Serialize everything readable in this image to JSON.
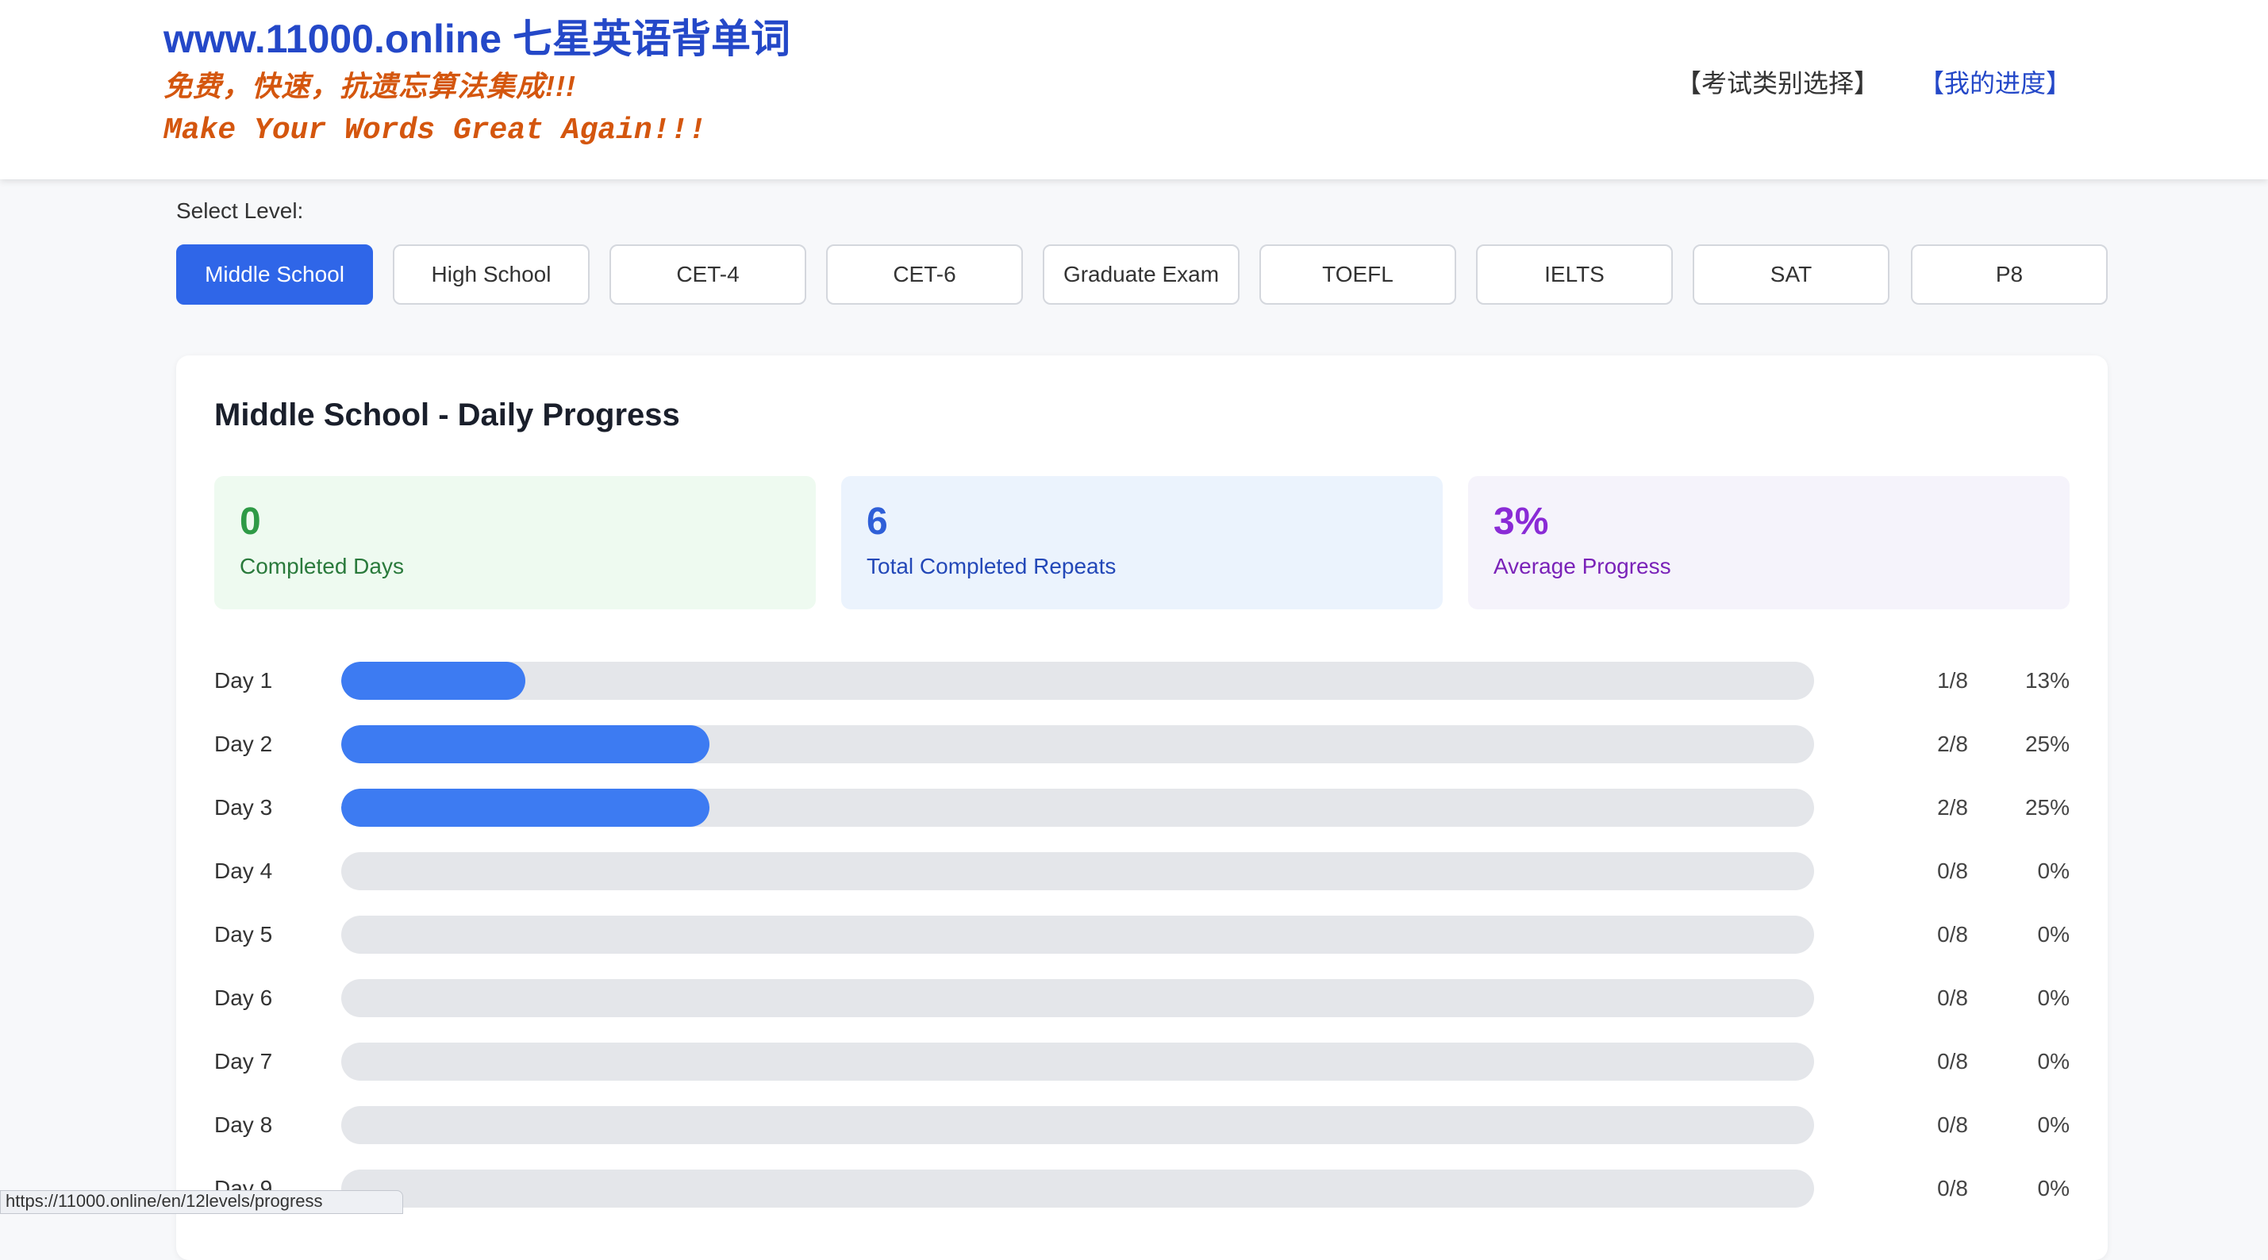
{
  "header": {
    "site_title": "www.11000.online 七星英语背单词",
    "slogan_cn": "免费，快速，抗遗忘算法集成!!!",
    "slogan_en": "Make Your Words Great Again!!!",
    "nav": {
      "exam_select": "【考试类别选择】",
      "my_progress": "【我的进度】"
    }
  },
  "level_select": {
    "label": "Select Level:",
    "active": "Middle School",
    "levels": [
      "Middle School",
      "High School",
      "CET-4",
      "CET-6",
      "Graduate Exam",
      "TOEFL",
      "IELTS",
      "SAT",
      "P8"
    ]
  },
  "progress": {
    "title": "Middle School - Daily Progress",
    "stats": {
      "completed_days": {
        "value": "0",
        "label": "Completed Days"
      },
      "total_repeats": {
        "value": "6",
        "label": "Total Completed Repeats"
      },
      "average_progress": {
        "value": "3%",
        "label": "Average Progress"
      }
    },
    "days": [
      {
        "label": "Day 1",
        "count": "1/8",
        "percent": "13%",
        "fraction": 0.125
      },
      {
        "label": "Day 2",
        "count": "2/8",
        "percent": "25%",
        "fraction": 0.25
      },
      {
        "label": "Day 3",
        "count": "2/8",
        "percent": "25%",
        "fraction": 0.25
      },
      {
        "label": "Day 4",
        "count": "0/8",
        "percent": "0%",
        "fraction": 0
      },
      {
        "label": "Day 5",
        "count": "0/8",
        "percent": "0%",
        "fraction": 0
      },
      {
        "label": "Day 6",
        "count": "0/8",
        "percent": "0%",
        "fraction": 0
      },
      {
        "label": "Day 7",
        "count": "0/8",
        "percent": "0%",
        "fraction": 0
      },
      {
        "label": "Day 8",
        "count": "0/8",
        "percent": "0%",
        "fraction": 0
      },
      {
        "label": "Day 9",
        "count": "0/8",
        "percent": "0%",
        "fraction": 0
      }
    ]
  },
  "status_bar": {
    "url": "https://11000.online/en/12levels/progress"
  },
  "colors": {
    "brand_blue": "#2448c8",
    "slogan_orange": "#d4560e",
    "active_button": "#2f66e8",
    "bar_fill": "#3d7bf2",
    "bar_track": "#e4e6ea"
  }
}
